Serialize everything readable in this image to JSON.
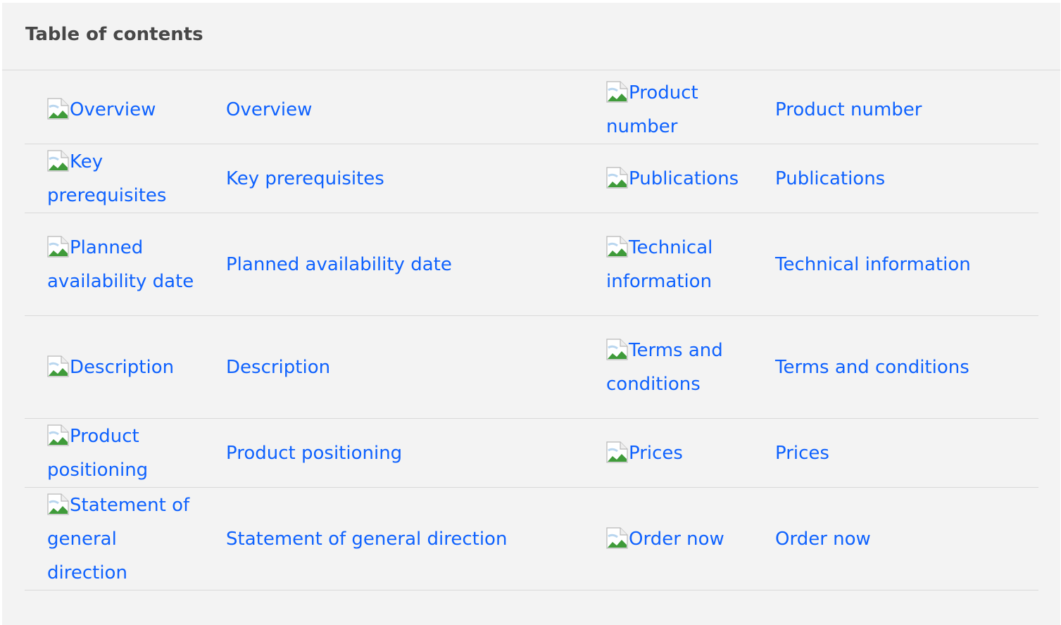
{
  "toc": {
    "title": "Table of contents",
    "rows": [
      {
        "left_img_alt": "Overview",
        "left_link": "Overview",
        "right_img_alt": "Product number",
        "right_link": "Product number"
      },
      {
        "left_img_alt": "Key prerequisites",
        "left_link": "Key prerequisites",
        "right_img_alt": "Publications",
        "right_link": "Publications"
      },
      {
        "left_img_alt": "Planned availability date",
        "left_link": "Planned availability date",
        "right_img_alt": "Technical information",
        "right_link": "Technical information"
      },
      {
        "left_img_alt": "Description",
        "left_link": "Description",
        "right_img_alt": "Terms and conditions",
        "right_link": "Terms and conditions"
      },
      {
        "left_img_alt": "Product positioning",
        "left_link": "Product positioning",
        "right_img_alt": "Prices",
        "right_link": "Prices"
      },
      {
        "left_img_alt": "Statement of general direction",
        "left_link": "Statement of general direction",
        "right_img_alt": "Order now",
        "right_link": "Order now"
      }
    ]
  },
  "icons": {
    "broken_image": "broken-image-icon"
  },
  "colors": {
    "link": "#0f62fe",
    "background": "#f3f3f3",
    "title": "#474747",
    "divider": "#d9d9d9"
  }
}
